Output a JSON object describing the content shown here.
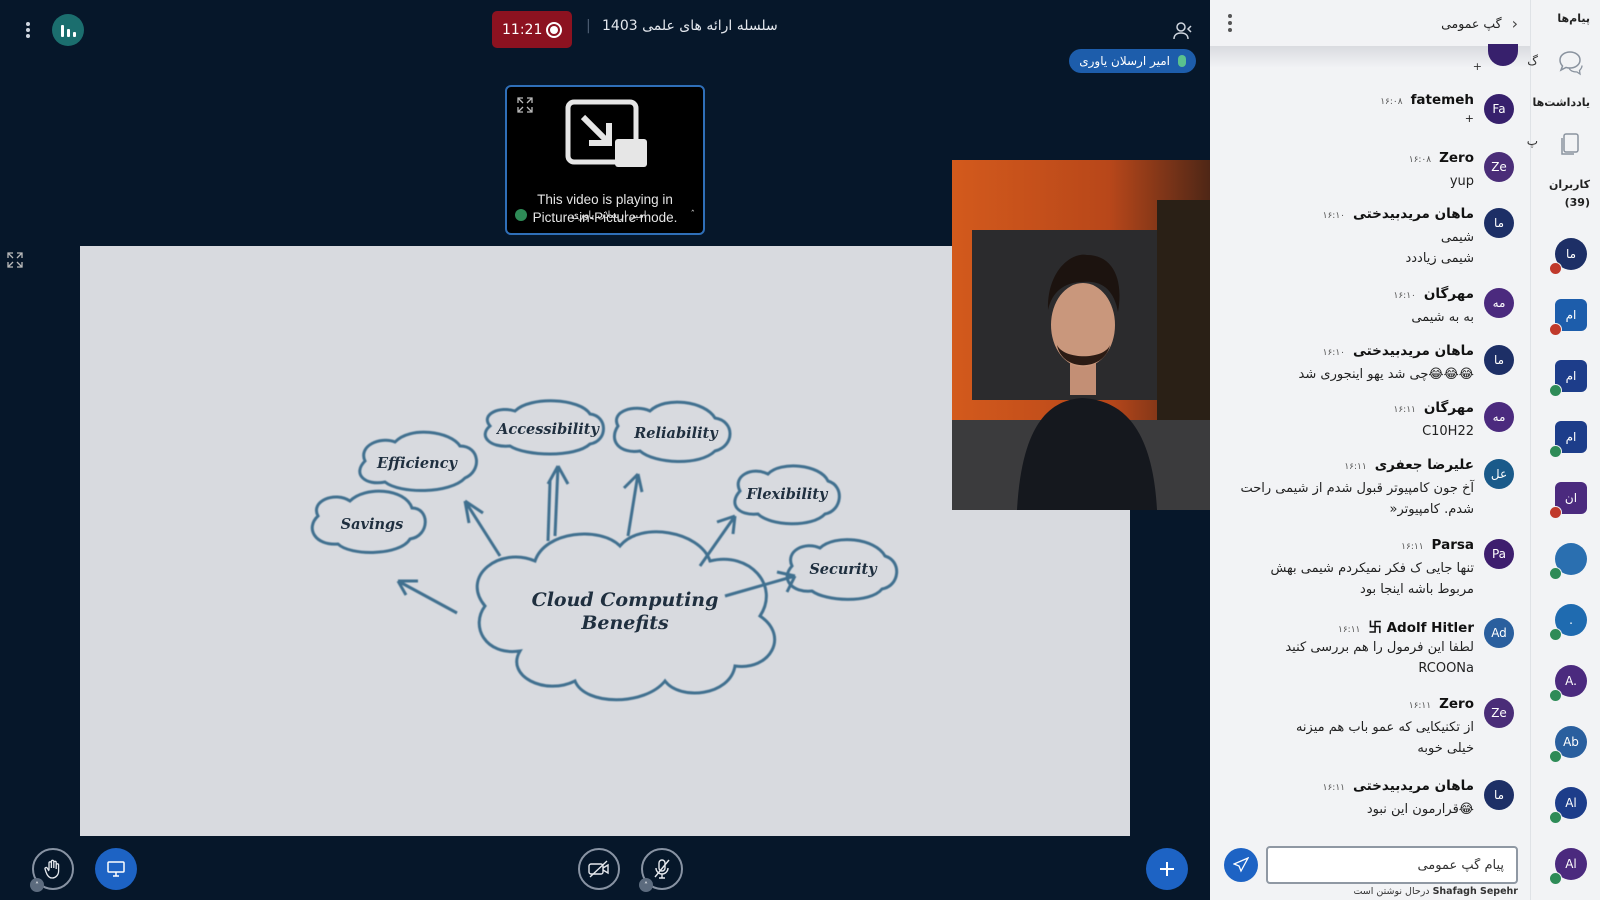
{
  "meeting": {
    "title": "سلسله ارائه های علمی 1403",
    "recording_time": "11:21",
    "speaker_name": "امیر ارسلان یاوری"
  },
  "pip": {
    "line1": "This video is playing in",
    "line2": "Picture-in-Picture mode.",
    "overlay_name": "امیر ارسلان یاوری"
  },
  "slide": {
    "center": [
      "Cloud Computing",
      "Benefits"
    ],
    "benefits": [
      "Savings",
      "Efficiency",
      "Accessibility",
      "Reliability",
      "Flexibility",
      "Security"
    ]
  },
  "chat": {
    "title": "گپ عمومی",
    "messages": [
      {
        "name": "fatemeh",
        "time": "۱۶:۰۸",
        "initials": "Fa",
        "color": "#37206c",
        "lines": [
          "+"
        ]
      },
      {
        "name": "Zero",
        "time": "۱۶:۰۸",
        "initials": "Ze",
        "color": "#4a2d78",
        "lines": [
          "yup"
        ]
      },
      {
        "name": "ماهان مریدبیدختی",
        "time": "۱۶:۱۰",
        "initials": "ما",
        "color": "#1d2f66",
        "lines": [
          "شیمی",
          "شیمی زیاددد"
        ]
      },
      {
        "name": "مهرگان",
        "time": "۱۶:۱۰",
        "initials": "مه",
        "color": "#4b2a7e",
        "lines": [
          "به به شیمی"
        ]
      },
      {
        "name": "ماهان مریدبیدختی",
        "time": "۱۶:۱۰",
        "initials": "ما",
        "color": "#1d2f66",
        "lines": [
          "😂😂😂چی شد یهو اینجوری شد"
        ]
      },
      {
        "name": "مهرگان",
        "time": "۱۶:۱۱",
        "initials": "مه",
        "color": "#4b2a7e",
        "lines": [
          "C10H22"
        ]
      },
      {
        "name": "علیرضا جعفری",
        "time": "۱۶:۱۱",
        "initials": "عل",
        "color": "#1a5a8a",
        "lines": [
          "آخ جون کامپیوتر قبول شدم از شیمی راحت",
          "شدم. کامپیوتر«"
        ]
      },
      {
        "name": "Parsa",
        "time": "۱۶:۱۱",
        "initials": "Pa",
        "color": "#3e1e6e",
        "lines": [
          "تنها جایی ک فکر نمیکردم شیمی بهش",
          "مربوط باشه اینجا بود"
        ]
      },
      {
        "name": "卐 Adolf Hitler",
        "time": "۱۶:۱۱",
        "initials": "Ad",
        "color": "#2a5f9e",
        "lines": [
          "لطفا این فرمول را هم بررسی کنید",
          "RCOONa"
        ]
      },
      {
        "name": "Zero",
        "time": "۱۶:۱۱",
        "initials": "Ze",
        "color": "#4a2d78",
        "lines": [
          "از تکنیکایی که عمو باب هم میزنه",
          "خیلی خوبه"
        ]
      },
      {
        "name": "ماهان مریدبیدختی",
        "time": "۱۶:۱۱",
        "initials": "ما",
        "color": "#1d2f66",
        "lines": [
          "😂قرارمون این نبود"
        ]
      }
    ],
    "input_placeholder": "پیام گپ عمومی",
    "typing_user": "Shafagh Sepehr",
    "typing_suffix": "درحال نوشتن است"
  },
  "rail": {
    "messages_label": "پیام‌ها",
    "notes_label": "یادداشت‌ها",
    "users_label": "کاربران",
    "users_count": "(39)",
    "chat_peek": "گ",
    "notes_peek": "پ",
    "users": [
      {
        "initials": "ما",
        "color": "#1d2f66",
        "status": "muted"
      },
      {
        "initials": "ام",
        "color": "#1d5dab",
        "status": "muted",
        "square": true
      },
      {
        "initials": "ام",
        "color": "#1d3d8a",
        "status": "ok",
        "square": true
      },
      {
        "initials": "ام",
        "color": "#1d3d8a",
        "status": "ok",
        "square": true
      },
      {
        "initials": "ان",
        "color": "#4b2a7e",
        "status": "muted",
        "square": true
      },
      {
        "initials": "",
        "color": "#2a6fb0",
        "status": "ok"
      },
      {
        "initials": ".",
        "color": "#1f6bb0",
        "status": "ok"
      },
      {
        "initials": "A.",
        "color": "#4b2a7e",
        "status": "ok"
      },
      {
        "initials": "Ab",
        "color": "#2a5f9e",
        "status": "ok"
      },
      {
        "initials": "Al",
        "color": "#1d3d8a",
        "status": "ok"
      },
      {
        "initials": "Al",
        "color": "#4b2a7e",
        "status": "ok"
      }
    ]
  }
}
